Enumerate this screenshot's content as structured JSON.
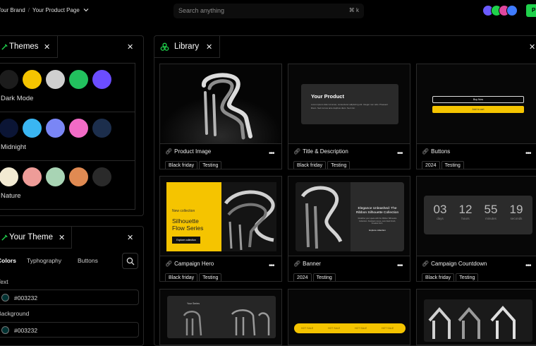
{
  "topbar": {
    "brand": "Your Brand",
    "page": "Your Product Page",
    "search_placeholder": "Search anything",
    "shortcut": "⌘ k",
    "publish": "P",
    "avatar_colors": [
      "#6b5bff",
      "#1fd14b",
      "#e0479e",
      "#3f7bff"
    ]
  },
  "themes_panel": {
    "title": "Themes",
    "rows": [
      {
        "name": "Dark Mode",
        "colors": [
          "#1c1c1c",
          "#f5c400",
          "#cfcfcf",
          "#22c15e",
          "#6b4dff"
        ]
      },
      {
        "name": "Midnight",
        "colors": [
          "#0b1535",
          "#3ab6f2",
          "#7a86f5",
          "#f26bc6",
          "#1c2e4c"
        ]
      },
      {
        "name": "Nature",
        "colors": [
          "#f2ead2",
          "#ee9c98",
          "#a8d4b4",
          "#e08a52",
          "#2a2a2a"
        ]
      }
    ]
  },
  "your_theme_panel": {
    "title": "Your Theme",
    "tabs": [
      "Colors",
      "Typhography",
      "Buttons"
    ],
    "text_label": "Text",
    "text_value": "#003232",
    "background_label": "Background",
    "background_value": "#003232"
  },
  "library_panel": {
    "title": "Library",
    "cards": [
      {
        "title": "Product Image",
        "tags": [
          "Black friday",
          "Testing"
        ]
      },
      {
        "title": "Title & Description",
        "tags": [
          "Black friday",
          "Testing"
        ]
      },
      {
        "title": "Buttons",
        "tags": [
          "2024",
          "Testing"
        ]
      },
      {
        "title": "Campaign Hero",
        "tags": [
          "Black friday",
          "Testing"
        ]
      },
      {
        "title": "Banner",
        "tags": [
          "2024",
          "Testing"
        ]
      },
      {
        "title": "Campaign Countdown",
        "tags": [
          "Black friday",
          "Testing"
        ]
      }
    ],
    "previews": {
      "product_title": "Your Product",
      "product_desc": "Lorem ipsum dolor sit amet, consectetur adipiscing elit. Integer nec odio. Praesent libero. Sed cursus ante dapibus diam. Sed nisi.",
      "buy_now": "Buy Now",
      "add_to_cart": "Add to cart",
      "hero_kicker": "New collection",
      "hero_title_1": "Silhouette",
      "hero_title_2": "Flow Series",
      "hero_button": "Explore collection",
      "banner_title_1": "Elegance Unleashed: The",
      "banner_title_2": "Ribbon Silhouette Collection",
      "banner_desc": "Redefine your space with the Ribbon Silhouette Collection. Sculpted curves, pure black finish, timeless form.",
      "banner_link": "Explore collection",
      "countdown": [
        {
          "value": "03",
          "unit": "days"
        },
        {
          "value": "12",
          "unit": "hours"
        },
        {
          "value": "55",
          "unit": "minutes"
        },
        {
          "value": "19",
          "unit": "seconds"
        }
      ],
      "series_label": "Your Series",
      "hot_sale": "HOT SALE"
    }
  }
}
